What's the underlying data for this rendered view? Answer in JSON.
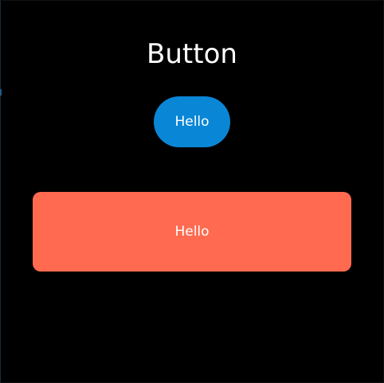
{
  "page": {
    "title": "Button"
  },
  "buttons": {
    "primary": {
      "label": "Hello",
      "color": "#0a86d6"
    },
    "secondary": {
      "label": "Hello",
      "color": "#ff6a50"
    }
  },
  "colors": {
    "background": "#000000",
    "text": "#ffffff"
  }
}
